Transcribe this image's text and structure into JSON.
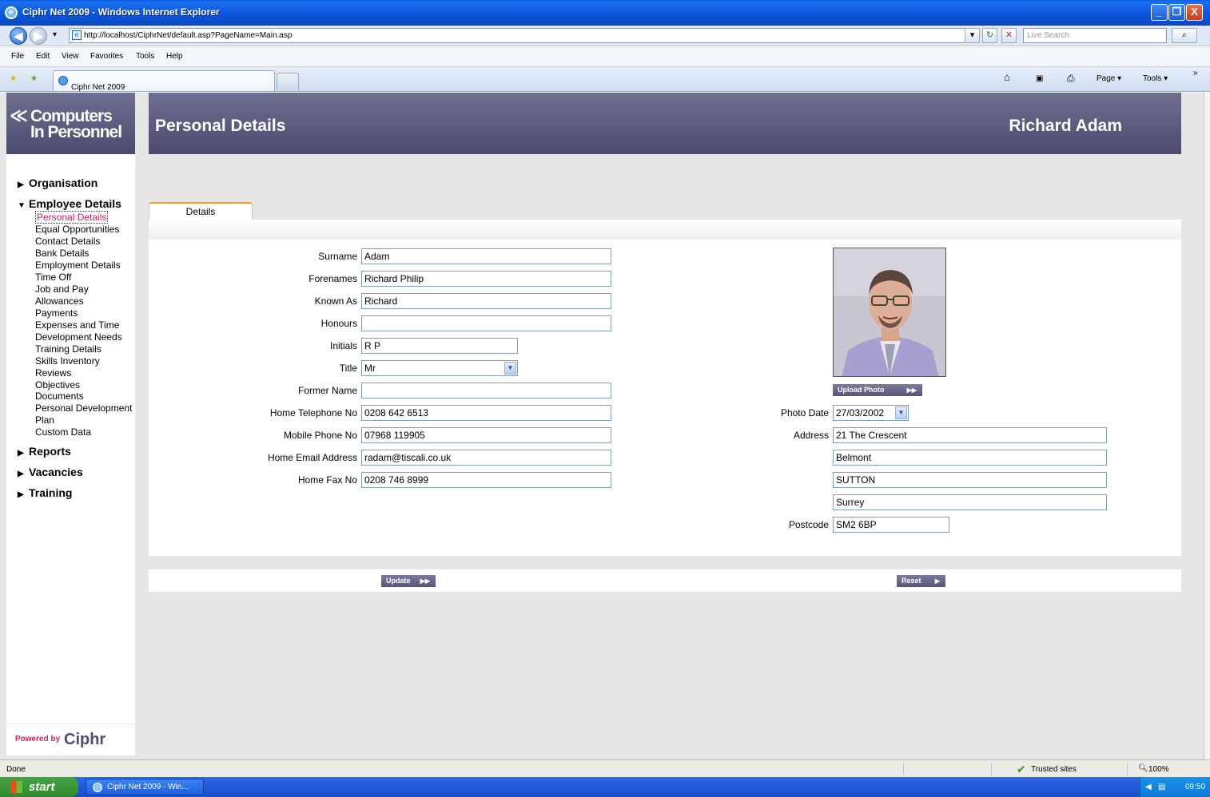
{
  "window": {
    "title": "Ciphr Net 2009 - Windows Internet Explorer",
    "minimize": "_",
    "maximize": "❐",
    "close": "X"
  },
  "browser": {
    "back": "◀",
    "forward": "▶",
    "dropdown": "▾",
    "url": "http://localhost/CiphrNet/default.asp?PageName=Main.asp",
    "refresh": "↻",
    "stop": "✕",
    "search_placeholder": "Live Search",
    "search_btn": "⌕",
    "menu": [
      "File",
      "Edit",
      "View",
      "Favorites",
      "Tools",
      "Help"
    ],
    "tab_title": "Ciphr Net 2009",
    "command_page": "Page ▾",
    "command_tools": "Tools ▾",
    "command_more": "»"
  },
  "app": {
    "logo_line1": "Computers",
    "logo_line2": "In Personnel",
    "page_title": "Personal Details",
    "employee_name": "Richard Adam",
    "powered_by": "Powered by",
    "powered_brand": "Ciphr"
  },
  "nav": {
    "sections": [
      {
        "label": "Organisation",
        "arrow": "▶"
      },
      {
        "label": "Employee Details",
        "arrow": "▼"
      },
      {
        "label": "Reports",
        "arrow": "▶"
      },
      {
        "label": "Vacancies",
        "arrow": "▶"
      },
      {
        "label": "Training",
        "arrow": "▶"
      }
    ],
    "employee_items": [
      "Personal Details",
      "Equal Opportunities",
      "Contact Details",
      "Bank Details",
      "Employment Details",
      "Time Off",
      "Job and Pay",
      "Allowances",
      "Payments",
      "Expenses and Time",
      "Development Needs",
      "Training Details",
      "Skills Inventory",
      "Reviews",
      "Objectives",
      "Documents",
      "Personal Development",
      "Plan",
      "Custom Data"
    ]
  },
  "form": {
    "tab": "Details",
    "left": [
      {
        "label": "Surname",
        "value": "Adam"
      },
      {
        "label": "Forenames",
        "value": "Richard Philip"
      },
      {
        "label": "Known As",
        "value": "Richard"
      },
      {
        "label": "Honours",
        "value": ""
      },
      {
        "label": "Initials",
        "value": "R P"
      },
      {
        "label": "Title",
        "value": "Mr"
      },
      {
        "label": "Former Name",
        "value": ""
      },
      {
        "label": "Home Telephone No",
        "value": "0208 642 6513"
      },
      {
        "label": "Mobile Phone No",
        "value": "07968 119905"
      },
      {
        "label": "Home Email Address",
        "value": "radam@tiscali.co.uk"
      },
      {
        "label": "Home Fax No",
        "value": "0208 746 8999"
      }
    ],
    "upload_photo": "Upload Photo",
    "photo_date_label": "Photo Date",
    "photo_date": "27/03/2002",
    "address_label": "Address",
    "address_lines": [
      "21 The Crescent",
      "Belmont",
      "SUTTON",
      "Surrey"
    ],
    "postcode_label": "Postcode",
    "postcode": "SM2 6BP",
    "update_btn": "Update",
    "reset_btn": "Reset"
  },
  "status": {
    "done": "Done",
    "zone": "Trusted sites",
    "zoom": "100%"
  },
  "taskbar": {
    "start": "start",
    "item": "Ciphr Net 2009 - Win...",
    "clock": "09:50"
  }
}
